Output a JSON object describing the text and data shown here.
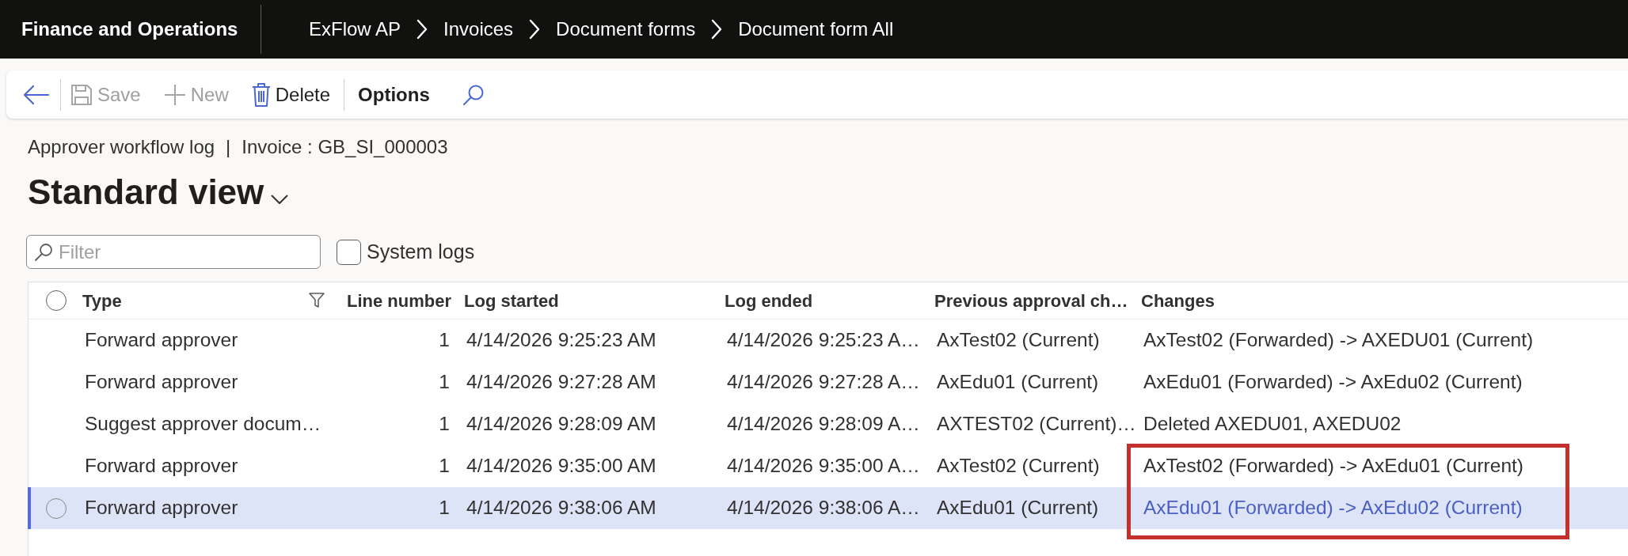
{
  "app_bar": {
    "title": "Finance and Operations",
    "breadcrumb": [
      "ExFlow AP",
      "Invoices",
      "Document forms",
      "Document form All"
    ]
  },
  "toolbar": {
    "groups": [
      {
        "items": [
          {
            "kind": "back",
            "disabled": false
          }
        ]
      },
      {
        "items": [
          {
            "kind": "save",
            "label": "Save",
            "disabled": true
          },
          {
            "kind": "new",
            "label": "New",
            "disabled": true
          },
          {
            "kind": "delete",
            "label": "Delete",
            "disabled": false
          }
        ]
      },
      {
        "items": [
          {
            "kind": "options",
            "label": "Options",
            "disabled": false
          },
          {
            "kind": "search",
            "disabled": false
          }
        ]
      }
    ]
  },
  "page": {
    "form_name": "Approver workflow log",
    "separator": "|",
    "record": "Invoice : GB_SI_000003",
    "view": "Standard view"
  },
  "filter": {
    "placeholder": "Filter"
  },
  "system_logs": {
    "label": "System logs",
    "checked": false
  },
  "table": {
    "select_all": {
      "checked": false
    },
    "columns": [
      {
        "label": "Type",
        "filtered": true
      },
      {
        "label": "Line number",
        "filtered": false
      },
      {
        "label": "Log started",
        "filtered": false
      },
      {
        "label": "Log ended",
        "filtered": false
      },
      {
        "label": "Previous approval ch…",
        "filtered": false
      },
      {
        "label": "Changes",
        "filtered": false
      }
    ],
    "rows": [
      {
        "cells": [
          "Forward approver",
          "1",
          "4/14/2026 9:25:23 AM",
          "4/14/2026 9:25:23 A…",
          "AxTest02 (Current)",
          "AxTest02 (Forwarded) -> AXEDU01 (Current)"
        ],
        "selected": false,
        "highlighted": false
      },
      {
        "cells": [
          "Forward approver",
          "1",
          "4/14/2026 9:27:28 AM",
          "4/14/2026 9:27:28 A…",
          "AxEdu01 (Current)",
          "AxEdu01 (Forwarded) -> AxEdu02 (Current)"
        ],
        "selected": false,
        "highlighted": false
      },
      {
        "cells": [
          "Suggest approver docum…",
          "1",
          "4/14/2026 9:28:09 AM",
          "4/14/2026 9:28:09 A…",
          "AXTEST02 (Current)…",
          "Deleted AXEDU01, AXEDU02"
        ],
        "selected": false,
        "highlighted": false
      },
      {
        "cells": [
          "Forward approver",
          "1",
          "4/14/2026 9:35:00 AM",
          "4/14/2026 9:35:00 A…",
          "AxTest02 (Current)",
          "AxTest02 (Forwarded) -> AxEdu01 (Current)"
        ],
        "selected": false,
        "highlighted": true
      },
      {
        "cells": [
          "Forward approver",
          "1",
          "4/14/2026 9:38:06 AM",
          "4/14/2026 9:38:06 A…",
          "AxEdu01 (Current)",
          "AxEdu01 (Forwarded) -> AxEdu02 (Current)"
        ],
        "selected": true,
        "highlighted": true
      }
    ]
  }
}
